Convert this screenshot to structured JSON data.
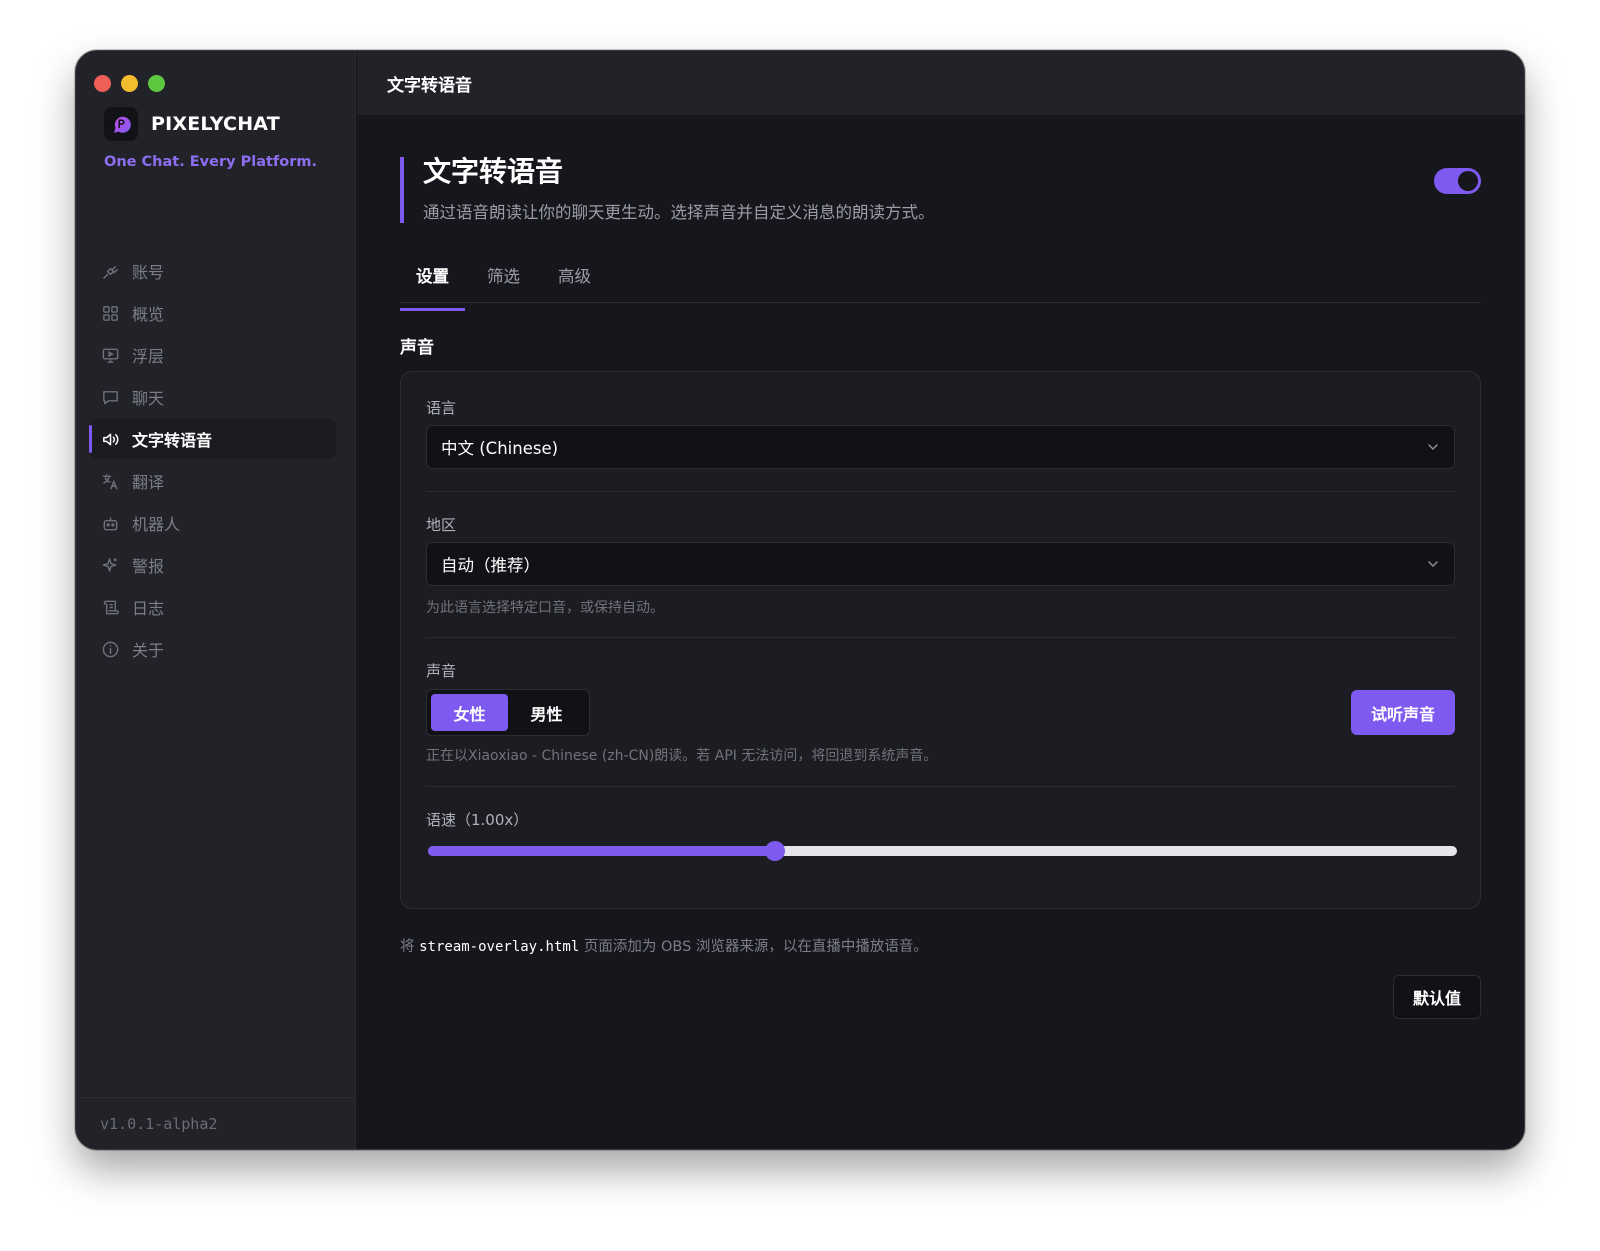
{
  "app": {
    "brand_name": "PIXELYCHAT",
    "tagline": "One Chat. Every Platform.",
    "version": "v1.0.1-alpha2"
  },
  "sidebar": {
    "items": [
      {
        "label": "账号",
        "icon": "plug-icon"
      },
      {
        "label": "概览",
        "icon": "grid-icon"
      },
      {
        "label": "浮层",
        "icon": "monitor-icon"
      },
      {
        "label": "聊天",
        "icon": "chat-bubble-icon"
      },
      {
        "label": "文字转语音",
        "icon": "speaker-icon",
        "active": true
      },
      {
        "label": "翻译",
        "icon": "translate-icon"
      },
      {
        "label": "机器人",
        "icon": "robot-icon"
      },
      {
        "label": "警报",
        "icon": "sparkle-icon"
      },
      {
        "label": "日志",
        "icon": "scroll-icon"
      },
      {
        "label": "关于",
        "icon": "info-icon"
      }
    ]
  },
  "topbar": {
    "title": "文字转语音"
  },
  "page": {
    "title": "文字转语音",
    "description": "通过语音朗读让你的聊天更生动。选择声音并自定义消息的朗读方式。",
    "enabled": true
  },
  "tabs": [
    {
      "label": "设置",
      "active": true
    },
    {
      "label": "筛选",
      "active": false
    },
    {
      "label": "高级",
      "active": false
    }
  ],
  "voice_section": {
    "title": "声音",
    "language": {
      "label": "语言",
      "value": "中文 (Chinese)"
    },
    "region": {
      "label": "地区",
      "value": "自动（推荐）",
      "hint": "为此语言选择特定口音，或保持自动。"
    },
    "voice": {
      "label": "声音",
      "options": [
        "女性",
        "男性"
      ],
      "selected": "女性",
      "preview_label": "试听声音",
      "hint": "正在以Xiaoxiao - Chinese (zh-CN)朗读。若 API 无法访问，将回退到系统声音。"
    },
    "rate": {
      "label": "语速（1.00x）",
      "value": 1.0,
      "fraction": 0.337
    }
  },
  "obs_note": {
    "prefix": "将",
    "filename": "stream-overlay.html",
    "suffix": "页面添加为 OBS 浏览器来源，以在直播中播放语音。"
  },
  "actions": {
    "default_label": "默认值"
  },
  "colors": {
    "accent": "#7f5af0",
    "background": "#16171c",
    "sidebar": "#222329"
  }
}
